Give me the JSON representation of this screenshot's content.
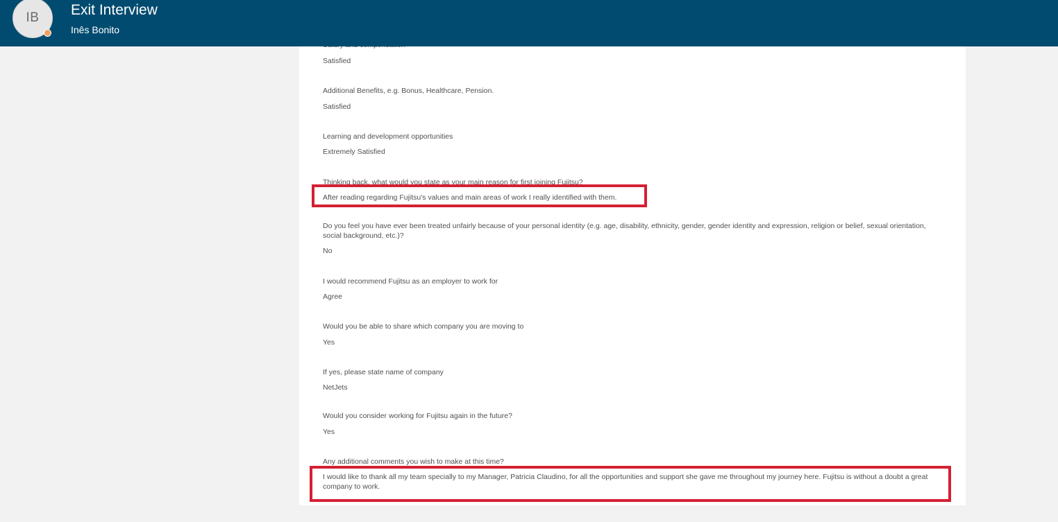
{
  "header": {
    "avatar_initials": "IB",
    "title": "Exit Interview",
    "subtitle": "Inês Bonito",
    "background": "#004b6f"
  },
  "qa": [
    {
      "question": "Salary and compensation",
      "answer": "Satisfied"
    },
    {
      "question": "Additional Benefits, e.g. Bonus, Healthcare, Pension.",
      "answer": "Satisfied"
    },
    {
      "question": "Learning and development opportunities",
      "answer": "Extremely Satisfied"
    },
    {
      "question": "Thinking back, what would you state as your main reason for first joining Fujitsu?",
      "answer": "After reading regarding Fujitsu's values and main areas of work I really identified with them."
    },
    {
      "question": "Do you feel you have ever been treated unfairly because of your personal identity (e.g. age, disability, ethnicity, gender, gender identity and expression, religion or belief, sexual orientation, social background, etc.)?",
      "answer": "No"
    },
    {
      "question": "I would recommend Fujitsu as an employer to work for",
      "answer": "Agree"
    },
    {
      "question": "Would you be able to share which company you are moving to",
      "answer": "Yes"
    },
    {
      "question": "If yes, please state name of company",
      "answer": "NetJets"
    },
    {
      "question": "Would you consider working for Fujitsu again in the future?",
      "answer": "Yes"
    },
    {
      "question": "Any additional comments you wish to make at this time?",
      "answer": "I would like to thank all my team specially to my Manager, Patricia Claudino, for all the opportunities and support she gave me throughout my journey here. Fujitsu is without a doubt a great company to work."
    }
  ],
  "colors": {
    "highlight": "#d42033",
    "page_background": "#f2f2f2",
    "panel_background": "#ffffff"
  }
}
